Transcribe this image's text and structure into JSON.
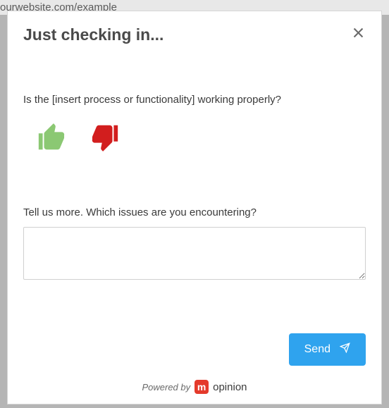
{
  "url_fragment": "ourwebsite.com/example",
  "modal": {
    "title": "Just checking in...",
    "question": "Is the [insert process or functionality] working properly?",
    "followup_label": "Tell us more. Which issues are you encountering?",
    "textarea_value": "",
    "send_label": "Send",
    "powered_by": "Powered by",
    "brand_letter": "m",
    "brand_name": "opinion"
  },
  "icons": {
    "close": "close-icon",
    "thumb_up": "thumb-up-icon",
    "thumb_down": "thumb-down-icon",
    "send": "paper-plane-icon"
  },
  "colors": {
    "thumb_up": "#8bc873",
    "thumb_down": "#d21e1e",
    "send_button": "#2fa3ee",
    "brand_badge": "#e43a2b"
  }
}
